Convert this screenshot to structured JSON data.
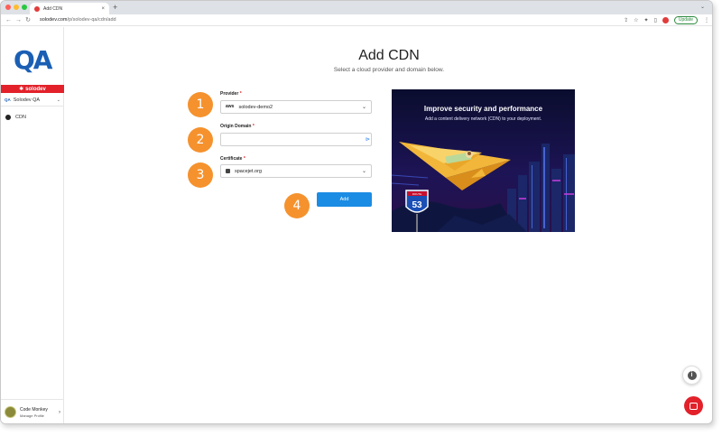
{
  "browser": {
    "tab_title": "Add CDN",
    "tab_close": "×",
    "new_tab": "+",
    "tabs_menu": "⌄",
    "url_domain": "solodev.com",
    "url_path": "/p/solodev-qa/cdn/add",
    "update_label": "Update"
  },
  "sidebar": {
    "logo_text": "QA",
    "brand_name": "solodev",
    "workspace_badge": "QA",
    "workspace_name": "Solodev QA",
    "nav_items": [
      {
        "label": "CDN"
      }
    ],
    "profile_name": "Code Monkey",
    "profile_sub": "Manage Profile"
  },
  "page": {
    "title": "Add CDN",
    "subtitle": "Select a cloud provider and domain below."
  },
  "form": {
    "provider_label": "Provider",
    "provider_value": "solodev-demo2",
    "provider_logo": "aws",
    "origin_label": "Origin Domain",
    "origin_value": "",
    "certificate_label": "Certificate",
    "certificate_value": "spacejet.org",
    "required_mark": "*",
    "add_label": "Add"
  },
  "steps": [
    "1",
    "2",
    "3",
    "4"
  ],
  "promo": {
    "title": "Improve security and performance",
    "subtitle": "Add a content delivery network (CDN) to your deployment.",
    "shield_top": "ROUTE",
    "shield_number": "53"
  },
  "colors": {
    "accent": "#1b8ce3",
    "brand_red": "#e2212a",
    "step_orange": "#f5922e"
  }
}
